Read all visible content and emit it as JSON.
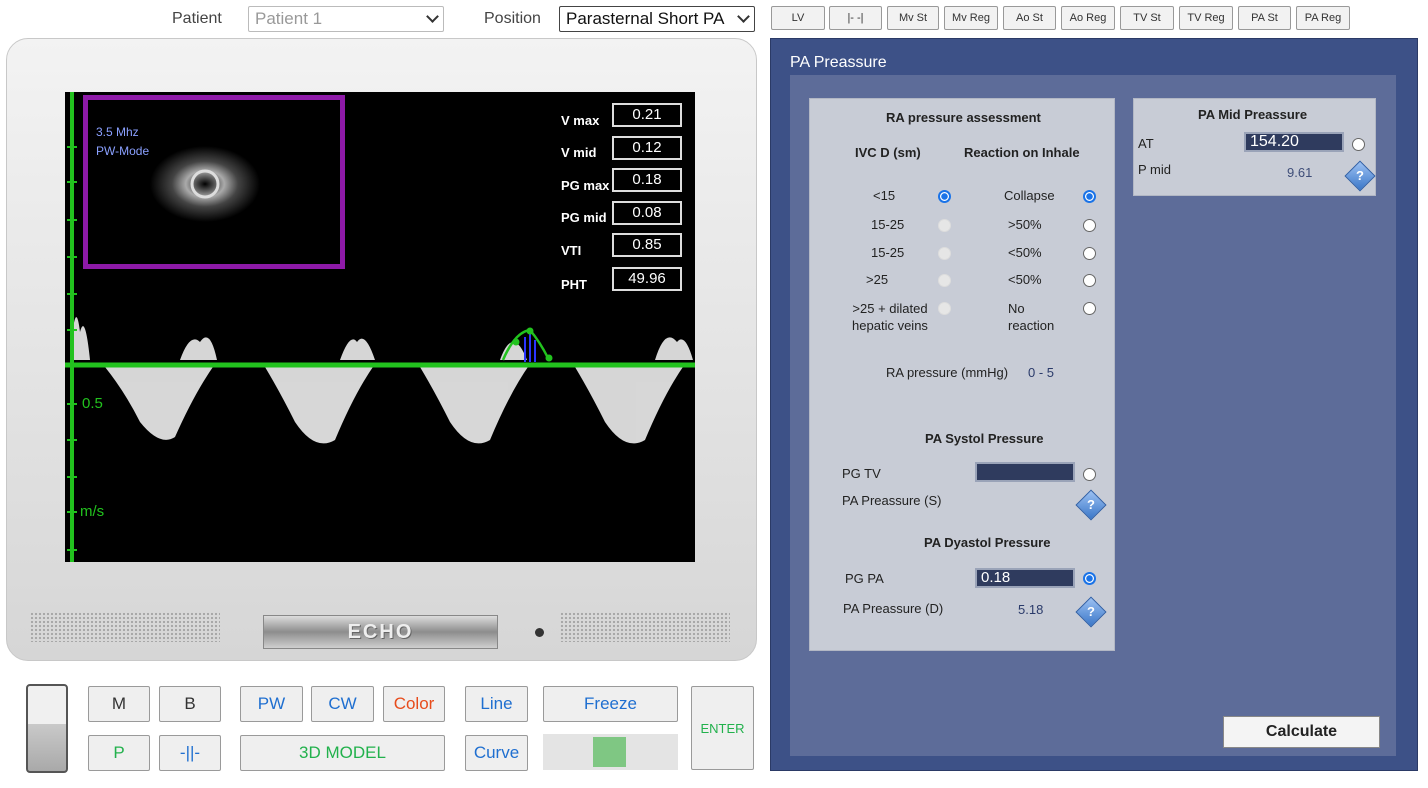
{
  "top": {
    "patient_label": "Patient",
    "patient_value": "Patient 1",
    "position_label": "Position",
    "position_value": "Parasternal Short PA",
    "tabs": [
      "LV",
      "|- -|",
      "Mv St",
      "Mv Reg",
      "Ao St",
      "Ao Reg",
      "TV St",
      "TV Reg",
      "PA St",
      "PA Reg"
    ]
  },
  "screen": {
    "probe_freq": "3.5 Mhz",
    "mode": "PW-Mode",
    "axis_label_1": "0.5",
    "axis_label_2": "m/s",
    "readouts": [
      {
        "label": "V max",
        "value": "0.21"
      },
      {
        "label": "V mid",
        "value": "0.12"
      },
      {
        "label": "PG max",
        "value": "0.18"
      },
      {
        "label": "PG mid",
        "value": "0.08"
      },
      {
        "label": "VTI",
        "value": "0.85"
      },
      {
        "label": "PHT",
        "value": "49.96"
      }
    ],
    "brand": "ECHO"
  },
  "controls": {
    "m": "M",
    "b": "B",
    "pw": "PW",
    "cw": "CW",
    "color": "Color",
    "line": "Line",
    "freeze": "Freeze",
    "enter": "ENTER",
    "p": "P",
    "sep": "-||-",
    "model": "3D MODEL",
    "curve": "Curve"
  },
  "panel": {
    "title": "PA Preassure",
    "ra": {
      "title": "RA pressure assessment",
      "col1": "IVC D (sm)",
      "col2": "Reaction on Inhale",
      "rows": [
        {
          "ivc": "<15",
          "reaction": "Collapse"
        },
        {
          "ivc": "15-25",
          "reaction": ">50%"
        },
        {
          "ivc": "15-25",
          "reaction": "<50%"
        },
        {
          "ivc": ">25",
          "reaction": "<50%"
        },
        {
          "ivc": ">25 + dilated\nhepatic veins",
          "reaction": "No\nreaction"
        }
      ],
      "pressure_label": "RA pressure (mmHg)",
      "pressure_value": "0 - 5"
    },
    "systol": {
      "title": "PA Systol Pressure",
      "pg_tv_label": "PG TV",
      "pg_tv_value": "",
      "pa_s_label": "PA Preassure (S)"
    },
    "dyastol": {
      "title": "PA Dyastol Pressure",
      "pg_pa_label": "PG PA",
      "pg_pa_value": "0.18",
      "pa_d_label": "PA Preassure (D)",
      "pa_d_value": "5.18"
    },
    "mid": {
      "title": "PA Mid Preassure",
      "at_label": "AT",
      "at_value": "154.20",
      "pmid_label": "P mid",
      "pmid_value": "9.61"
    },
    "help_glyph": "?",
    "calculate": "Calculate"
  },
  "colors": {
    "accent_green": "#22c21e",
    "panel_blue": "#3d5187",
    "roi_purple": "#8e1aa8"
  }
}
